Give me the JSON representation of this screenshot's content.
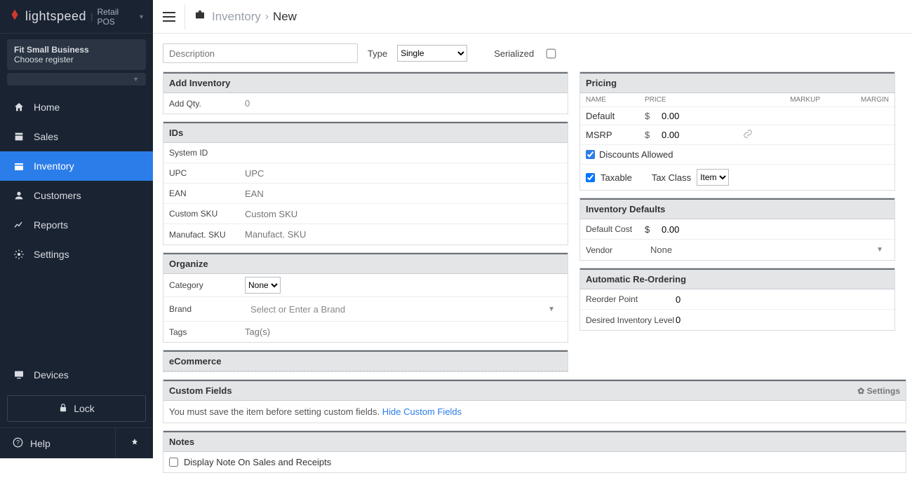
{
  "brand": {
    "name": "lightspeed",
    "product": "Retail POS"
  },
  "biz": {
    "line1": "Fit Small Business",
    "line2": "Choose register"
  },
  "nav": {
    "items": [
      {
        "label": "Home",
        "icon": "home"
      },
      {
        "label": "Sales",
        "icon": "sales"
      },
      {
        "label": "Inventory",
        "icon": "inventory",
        "active": true
      },
      {
        "label": "Customers",
        "icon": "customers"
      },
      {
        "label": "Reports",
        "icon": "reports"
      },
      {
        "label": "Settings",
        "icon": "settings"
      }
    ],
    "devices": "Devices",
    "lock": "Lock",
    "help": "Help"
  },
  "crumb": {
    "root": "Inventory",
    "leaf": "New"
  },
  "top": {
    "desc_ph": "Description",
    "type_label": "Type",
    "type_value": "Single",
    "serialized_label": "Serialized"
  },
  "addInv": {
    "hd": "Add Inventory",
    "qty_label": "Add Qty.",
    "qty_val": "0"
  },
  "ids": {
    "hd": "IDs",
    "sysid": "System ID",
    "upc": {
      "label": "UPC",
      "ph": "UPC"
    },
    "ean": {
      "label": "EAN",
      "ph": "EAN"
    },
    "csku": {
      "label": "Custom SKU",
      "ph": "Custom SKU"
    },
    "msku": {
      "label": "Manufact. SKU",
      "ph": "Manufact. SKU"
    }
  },
  "org": {
    "hd": "Organize",
    "cat": {
      "label": "Category",
      "val": "None"
    },
    "brand": {
      "label": "Brand",
      "ph": "Select or Enter a Brand"
    },
    "tags": {
      "label": "Tags",
      "ph": "Tag(s)"
    }
  },
  "ecom": {
    "hd": "eCommerce"
  },
  "pricing": {
    "hd": "Pricing",
    "cols": {
      "name": "NAME",
      "price": "PRICE",
      "markup": "MARKUP",
      "margin": "MARGIN"
    },
    "rows": [
      {
        "name": "Default",
        "cur": "$",
        "val": "0.00"
      },
      {
        "name": "MSRP",
        "cur": "$",
        "val": "0.00",
        "link": true
      }
    ],
    "disc": "Discounts Allowed",
    "taxable": "Taxable",
    "taxclass": "Tax Class",
    "taxsel": "Item"
  },
  "invdef": {
    "hd": "Inventory Defaults",
    "cost": {
      "label": "Default Cost",
      "cur": "$",
      "val": "0.00"
    },
    "vendor": {
      "label": "Vendor",
      "val": "None"
    }
  },
  "reorder": {
    "hd": "Automatic Re-Ordering",
    "point": {
      "label": "Reorder Point",
      "val": "0"
    },
    "desired": {
      "label": "Desired Inventory Level",
      "val": "0"
    }
  },
  "cf": {
    "hd": "Custom Fields",
    "settings": "Settings",
    "msg": "You must save the item before setting custom fields. ",
    "link": "Hide Custom Fields"
  },
  "notes": {
    "hd": "Notes",
    "display": "Display Note On Sales and Receipts"
  }
}
